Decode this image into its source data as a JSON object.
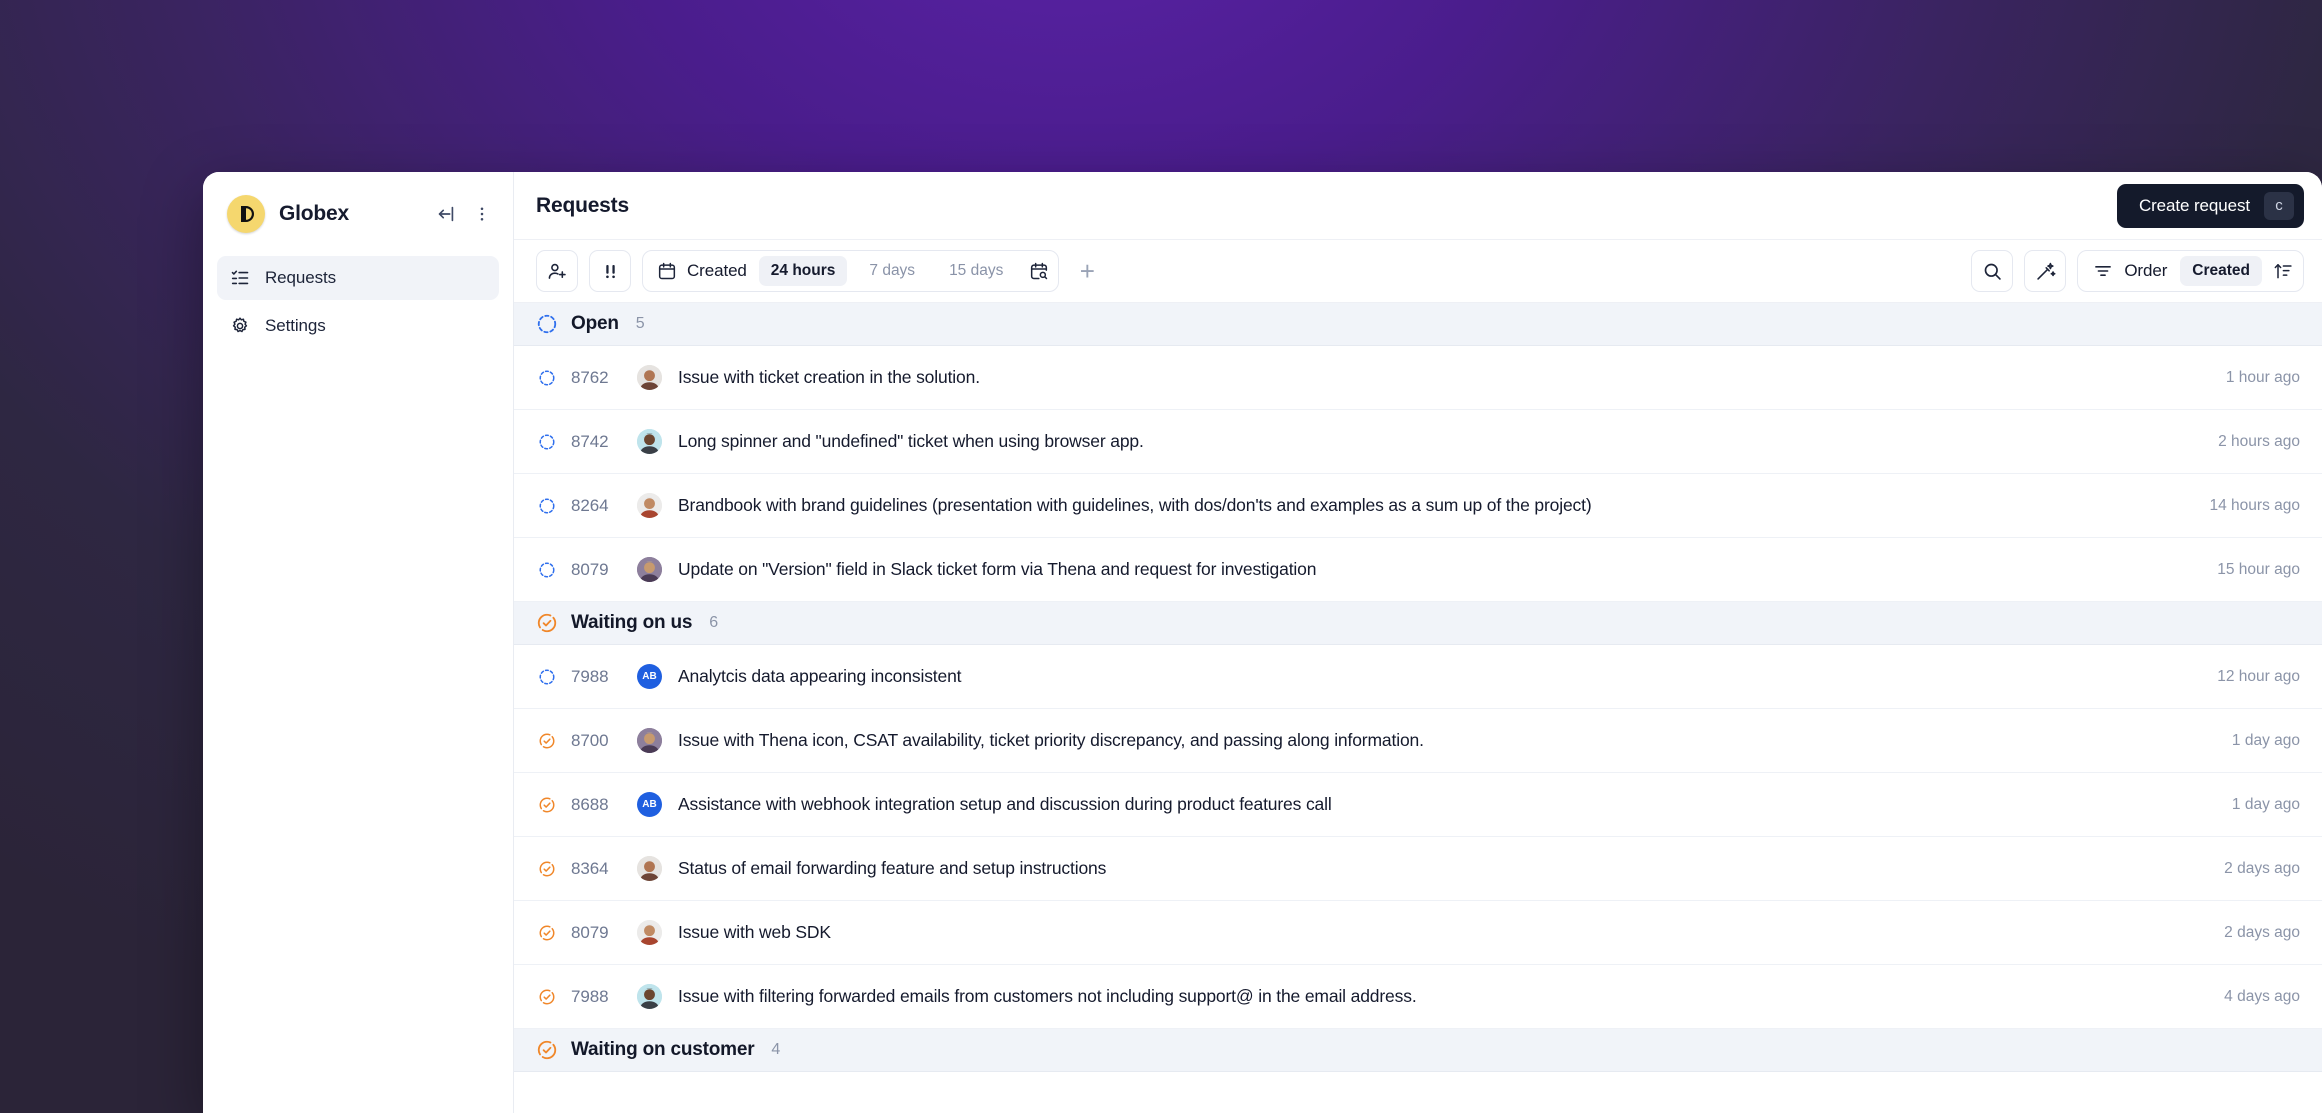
{
  "workspace": {
    "name": "Globex",
    "logo_icon": "globex-logo-icon",
    "collapse_icon": "collapse-sidebar-icon",
    "more_icon": "more-vertical-icon"
  },
  "sidebar": {
    "items": [
      {
        "label": "Requests",
        "icon": "list-check-icon",
        "active": true
      },
      {
        "label": "Settings",
        "icon": "gear-icon",
        "active": false
      }
    ]
  },
  "header": {
    "title": "Requests",
    "create_button": {
      "label": "Create request",
      "shortcut": "c"
    }
  },
  "toolbar": {
    "assign_icon": "user-plus-icon",
    "priority_icon": "priority-double-bang-icon",
    "date_filter": {
      "icon": "calendar-icon",
      "label": "Created",
      "options": [
        "24 hours",
        "7 days",
        "15 days"
      ],
      "selected": "24 hours",
      "custom_range_icon": "calendar-search-icon"
    },
    "add_filter_label": "+",
    "search_icon": "search-icon",
    "magic_icon": "magic-wand-icon",
    "order": {
      "icon": "filter-lines-icon",
      "label": "Order",
      "value": "Created",
      "direction_icon": "sort-ascending-icon"
    }
  },
  "colors": {
    "accent_purple": "#4a1d8c",
    "status_open": "#2f6fed",
    "status_waiting": "#f0872a",
    "brand_yellow": "#f5d76e",
    "dark_button": "#141a2b"
  },
  "groups": [
    {
      "title": "Open",
      "count": "5",
      "status_icon": "dashed-circle-icon",
      "status_color": "open",
      "rows": [
        {
          "id": "8762",
          "status": "open",
          "avatar": {
            "type": "photo",
            "tone": "p1"
          },
          "title": "Issue with ticket creation in the solution.",
          "time": "1 hour ago"
        },
        {
          "id": "8742",
          "status": "open",
          "avatar": {
            "type": "photo",
            "tone": "p2"
          },
          "title": "Long spinner and \"undefined\" ticket when using browser app.",
          "time": "2 hours ago"
        },
        {
          "id": "8264",
          "status": "open",
          "avatar": {
            "type": "photo",
            "tone": "p3"
          },
          "title": "Brandbook with brand guidelines (presentation with guidelines, with dos/don'ts and examples as a sum up of the project)",
          "time": "14 hours ago"
        },
        {
          "id": "8079",
          "status": "open",
          "avatar": {
            "type": "photo",
            "tone": "p4"
          },
          "title": "Update on \"Version\" field in Slack ticket form via Thena and request for investigation",
          "time": "15 hour ago"
        }
      ]
    },
    {
      "title": "Waiting on us",
      "count": "6",
      "status_icon": "waiting-check-circle-icon",
      "status_color": "waiting",
      "rows": [
        {
          "id": "7988",
          "status": "open",
          "avatar": {
            "type": "initials",
            "text": "AB",
            "bg": "#1f5fe0"
          },
          "title": "Analytcis data appearing inconsistent",
          "time": "12 hour ago"
        },
        {
          "id": "8700",
          "status": "waiting",
          "avatar": {
            "type": "photo",
            "tone": "p4"
          },
          "title": "Issue with Thena icon, CSAT availability, ticket priority discrepancy, and passing along information.",
          "time": "1 day ago"
        },
        {
          "id": "8688",
          "status": "waiting",
          "avatar": {
            "type": "initials",
            "text": "AB",
            "bg": "#1f5fe0"
          },
          "title": "Assistance with webhook integration setup and discussion during product features call",
          "time": "1 day ago"
        },
        {
          "id": "8364",
          "status": "waiting",
          "avatar": {
            "type": "photo",
            "tone": "p1"
          },
          "title": "Status of email forwarding feature and setup instructions",
          "time": "2 days ago"
        },
        {
          "id": "8079",
          "status": "waiting",
          "avatar": {
            "type": "photo",
            "tone": "p3"
          },
          "title": "Issue with web SDK",
          "time": "2 days ago"
        },
        {
          "id": "7988",
          "status": "waiting",
          "avatar": {
            "type": "photo",
            "tone": "p2"
          },
          "title": "Issue with filtering forwarded emails from customers not including support@ in the email address.",
          "time": "4 days ago"
        }
      ]
    },
    {
      "title": "Waiting on customer",
      "count": "4",
      "status_icon": "waiting-check-circle-icon",
      "status_color": "waiting",
      "rows": []
    }
  ]
}
